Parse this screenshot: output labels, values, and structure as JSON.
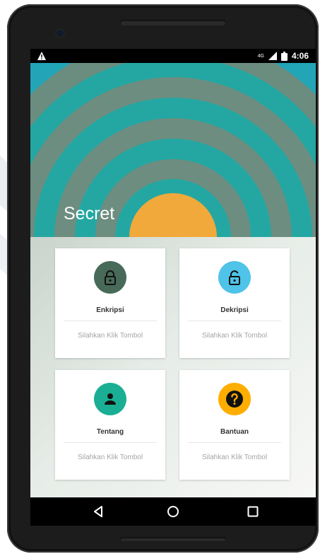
{
  "status_bar": {
    "time": "4:06",
    "network": "4G",
    "icons": [
      "warning-icon",
      "signal-icon",
      "battery-icon"
    ]
  },
  "app": {
    "title": "Secret"
  },
  "cards": [
    {
      "title": "Enkripsi",
      "subtitle": "Silahkan Klik Tombol",
      "icon": "lock-closed-icon",
      "color": "#476a59"
    },
    {
      "title": "Dekripsi",
      "subtitle": "Silahkan Klik Tombol",
      "icon": "lock-open-icon",
      "color": "#4fc3e8"
    },
    {
      "title": "Tentang",
      "subtitle": "Silahkan Klik Tombol",
      "icon": "person-icon",
      "color": "#1aaf95"
    },
    {
      "title": "Bantuan",
      "subtitle": "Silahkan Klik Tombol",
      "icon": "help-icon",
      "color": "#ffae00"
    }
  ],
  "nav": {
    "icons": [
      "back-icon",
      "home-icon",
      "recents-icon"
    ]
  },
  "theme": {
    "hero_teal": "#1ea7a3",
    "hero_gray": "#6d8d80",
    "hero_sun": "#f2a93b",
    "screen_bg": "#eef1ee"
  }
}
